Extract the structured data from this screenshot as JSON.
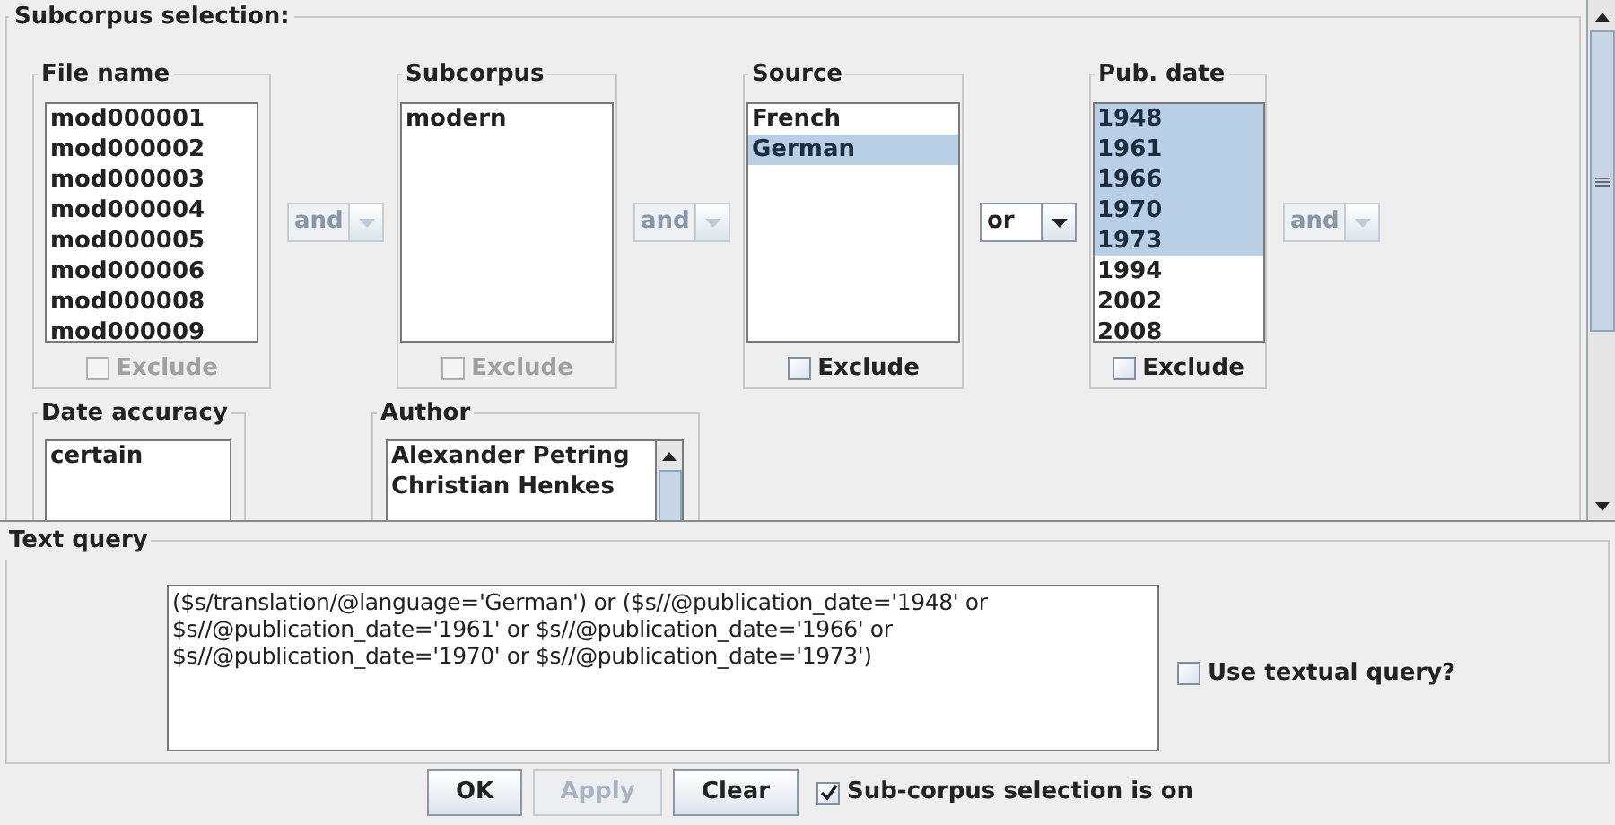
{
  "subcorpus_panel": {
    "title": "Subcorpus selection:",
    "fields": [
      {
        "label": "File name",
        "items": [
          {
            "text": "mod000001",
            "selected": false
          },
          {
            "text": "mod000002",
            "selected": false
          },
          {
            "text": "mod000003",
            "selected": false
          },
          {
            "text": "mod000004",
            "selected": false
          },
          {
            "text": "mod000005",
            "selected": false
          },
          {
            "text": "mod000006",
            "selected": false
          },
          {
            "text": "mod000008",
            "selected": false
          },
          {
            "text": "mod000009",
            "selected": false
          }
        ],
        "exclude": {
          "label": "Exclude",
          "checked": false,
          "disabled": true
        }
      },
      {
        "label": "Subcorpus",
        "items": [
          {
            "text": "modern",
            "selected": false
          }
        ],
        "exclude": {
          "label": "Exclude",
          "checked": false,
          "disabled": true
        }
      },
      {
        "label": "Source",
        "items": [
          {
            "text": "French",
            "selected": false
          },
          {
            "text": "German",
            "selected": true
          }
        ],
        "exclude": {
          "label": "Exclude",
          "checked": false,
          "disabled": false
        }
      },
      {
        "label": "Pub. date",
        "items": [
          {
            "text": "1948",
            "selected": true
          },
          {
            "text": "1961",
            "selected": true
          },
          {
            "text": "1966",
            "selected": true
          },
          {
            "text": "1970",
            "selected": true
          },
          {
            "text": "1973",
            "selected": true
          },
          {
            "text": "1994",
            "selected": false
          },
          {
            "text": "2002",
            "selected": false
          },
          {
            "text": "2008",
            "selected": false
          }
        ],
        "exclude": {
          "label": "Exclude",
          "checked": false,
          "disabled": false
        }
      }
    ],
    "connectors": [
      {
        "value": "and",
        "disabled": true
      },
      {
        "value": "and",
        "disabled": true
      },
      {
        "value": "or",
        "disabled": false
      },
      {
        "value": "and",
        "disabled": true
      }
    ],
    "fields_row_2": [
      {
        "label": "Date accuracy",
        "items": [
          {
            "text": "certain",
            "selected": false
          }
        ]
      },
      {
        "label": "Author",
        "items": [
          {
            "text": "Alexander Petring",
            "selected": false
          },
          {
            "text": "Christian Henkes",
            "selected": false
          }
        ]
      }
    ]
  },
  "text_query": {
    "title": "Text query",
    "query_lines": [
      "($s/translation/@language='German') or ($s//@publication_date='1948' or",
      "$s//@publication_date='1961' or $s//@publication_date='1966' or",
      "$s//@publication_date='1970' or $s//@publication_date='1973')"
    ],
    "use_textual_query": {
      "label": "Use textual query?",
      "checked": false
    }
  },
  "buttons": [
    {
      "label": "OK",
      "disabled": false
    },
    {
      "label": "Apply",
      "disabled": true
    },
    {
      "label": "Clear",
      "disabled": false
    }
  ],
  "subcorpus_on": {
    "label": "Sub-corpus selection is on",
    "checked": true
  }
}
